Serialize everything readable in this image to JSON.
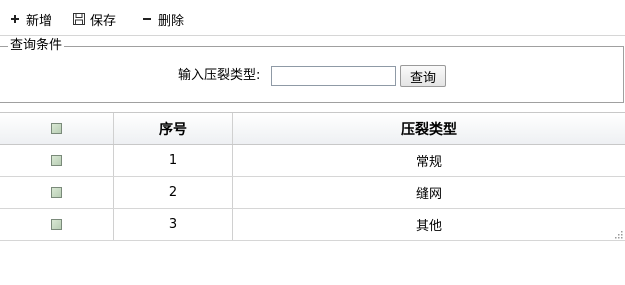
{
  "toolbar": {
    "add_label": "新增",
    "save_label": "保存",
    "delete_label": "删除"
  },
  "query": {
    "legend": "查询条件",
    "field_label": "输入压裂类型:",
    "field_value": "",
    "button_label": "查询"
  },
  "grid": {
    "columns": [
      "",
      "序号",
      "压裂类型"
    ],
    "rows": [
      {
        "no": "1",
        "type": "常规"
      },
      {
        "no": "2",
        "type": "缝网"
      },
      {
        "no": "3",
        "type": "其他"
      }
    ]
  },
  "icons": {
    "add": "plus-icon",
    "save": "floppy-disk-icon",
    "delete": "minus-icon"
  },
  "colors": {
    "header_bg": "#eef0f3",
    "checkbox_fill": "#c8dbc3",
    "border": "#c8c8c8"
  }
}
